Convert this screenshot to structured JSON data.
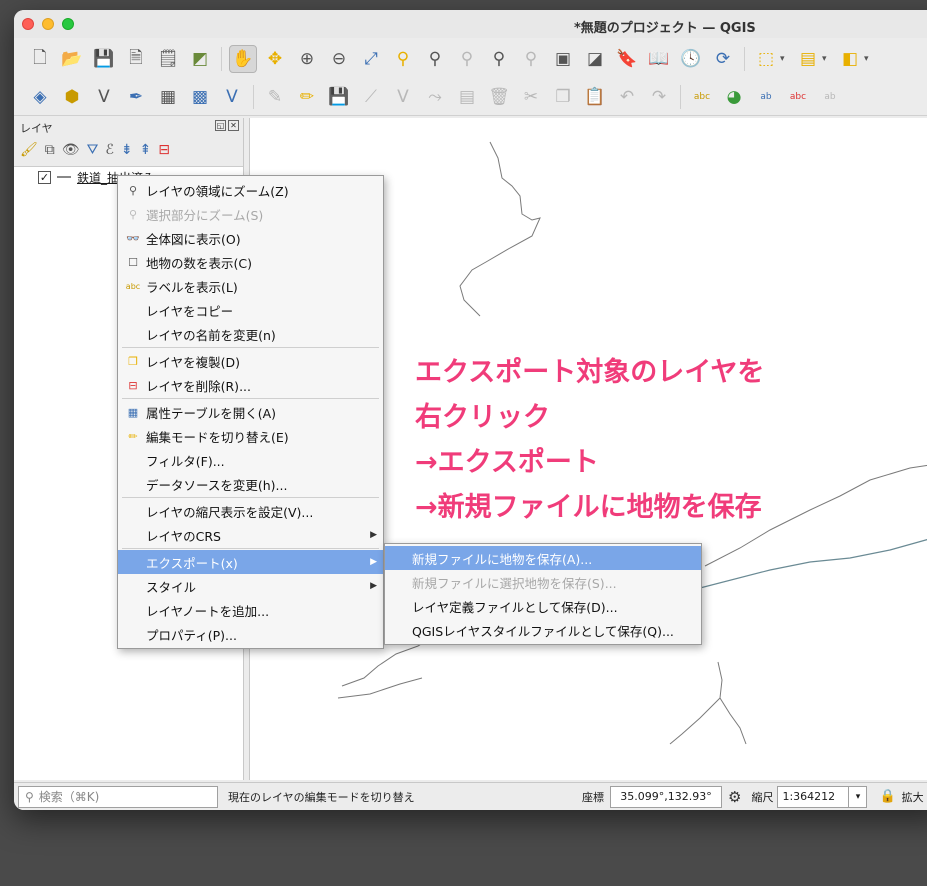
{
  "window": {
    "title": "*無題のプロジェクト — QGIS"
  },
  "toolbar1": {
    "icons": [
      "new-project",
      "open-project",
      "save-project",
      "save-as",
      "print-layout",
      "style-manager",
      "pan",
      "pan-to-selection",
      "zoom-in",
      "zoom-out",
      "zoom-full",
      "zoom-to-selection",
      "zoom-to-layer",
      "zoom-native",
      "zoom-last",
      "zoom-next",
      "new-map-view",
      "new-3d-view",
      "bookmark",
      "show-bookmarks",
      "refresh-time",
      "refresh",
      "select-features",
      "attribute-table",
      "deselect"
    ]
  },
  "toolbar2": {
    "icons": [
      "data-source-manager",
      "new-geopackage",
      "new-shapefile",
      "new-spatialite",
      "new-temp-layer",
      "new-virtual",
      "new-mesh",
      "digitize",
      "toggle-edit",
      "save-edits",
      "add-feature",
      "vertex-tool",
      "modify-attributes",
      "delete",
      "cut",
      "copy",
      "paste",
      "undo",
      "redo",
      "label-tool",
      "diagram",
      "label-pin",
      "label-unpin",
      "label-move"
    ]
  },
  "layers_panel": {
    "title": "レイヤ",
    "layers": [
      {
        "name": "鉄道_抽出済み",
        "checked": "✓"
      }
    ]
  },
  "context_menu": {
    "items": [
      {
        "label": "レイヤの領域にズーム(Z)",
        "icon": "zoom-icon",
        "disabled": false
      },
      {
        "label": "選択部分にズーム(S)",
        "icon": "zoom-icon",
        "disabled": true
      },
      {
        "label": "全体図に表示(O)",
        "icon": "overview-icon",
        "disabled": false
      },
      {
        "label": "地物の数を表示(C)",
        "icon": "checkbox-icon",
        "disabled": false
      },
      {
        "label": "ラベルを表示(L)",
        "icon": "label-icon",
        "disabled": false
      },
      {
        "label": "レイヤをコピー",
        "icon": "",
        "disabled": false
      },
      {
        "label": "レイヤの名前を変更(n)",
        "icon": "",
        "disabled": false
      },
      {
        "label": "レイヤを複製(D)",
        "icon": "duplicate-icon",
        "disabled": false
      },
      {
        "label": "レイヤを削除(R)...",
        "icon": "remove-icon",
        "disabled": false
      },
      {
        "label": "属性テーブルを開く(A)",
        "icon": "table-icon",
        "disabled": false
      },
      {
        "label": "編集モードを切り替え(E)",
        "icon": "pencil-icon",
        "disabled": false
      },
      {
        "label": "フィルタ(F)...",
        "icon": "",
        "disabled": false
      },
      {
        "label": "データソースを変更(h)...",
        "icon": "",
        "disabled": false
      },
      {
        "label": "レイヤの縮尺表示を設定(V)...",
        "icon": "",
        "disabled": false
      },
      {
        "label": "レイヤのCRS",
        "icon": "",
        "disabled": false
      },
      {
        "label": "エクスポート(x)",
        "icon": "",
        "disabled": false
      },
      {
        "label": "スタイル",
        "icon": "",
        "disabled": false
      },
      {
        "label": "レイヤノートを追加...",
        "icon": "",
        "disabled": false
      },
      {
        "label": "プロパティ(P)...",
        "icon": "",
        "disabled": false
      }
    ]
  },
  "submenu": {
    "items": [
      {
        "label": "新規ファイルに地物を保存(A)..."
      },
      {
        "label": "新規ファイルに選択地物を保存(S)..."
      },
      {
        "label": "レイヤ定義ファイルとして保存(D)..."
      },
      {
        "label": "QGISレイヤスタイルファイルとして保存(Q)..."
      }
    ]
  },
  "annotation": {
    "lines": [
      "エクスポート対象のレイヤを",
      "右クリック",
      "→エクスポート",
      "→新規ファイルに地物を保存"
    ],
    "color": "#f03c7a"
  },
  "statusbar": {
    "search_placeholder": "検索（⌘K)",
    "message": "現在のレイヤの編集モードを切り替え",
    "coord_label": "座標",
    "coord_value": "35.099°,132.93°",
    "scale_label": "縮尺",
    "scale_value": "1:364212",
    "zoom_label": "拡大"
  }
}
